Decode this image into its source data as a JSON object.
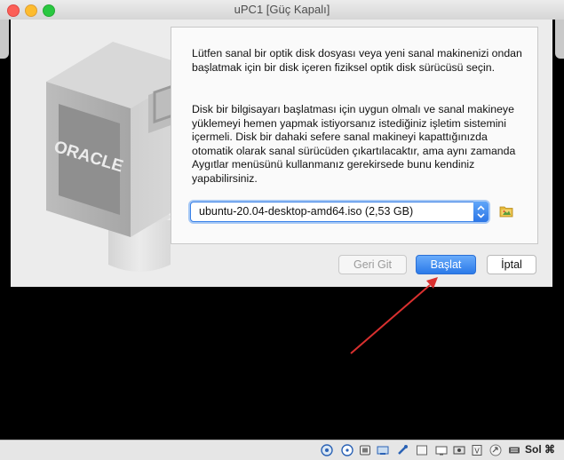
{
  "window": {
    "title": "uPC1 [Güç Kapalı]"
  },
  "logo": {
    "text": "ORACLE"
  },
  "dialog": {
    "paragraph1": "Lütfen sanal bir optik disk dosyası veya yeni sanal makinenizi ondan başlatmak için bir disk içeren fiziksel optik disk sürücüsü seçin.",
    "paragraph2": "Disk bir bilgisayarı başlatması için uygun olmalı ve sanal makineye yüklemeyi hemen yapmak istiyorsanız istediğiniz işletim sistemini içermeli. Disk bir dahaki sefere sanal makineyi kapattığınızda otomatik olarak sanal sürücüden çıkartılacaktır, ama aynı zamanda Aygıtlar menüsünü kullanmanız gerekirsede bunu kendiniz yapabilirsiniz.",
    "disk_select": {
      "value": "ubuntu-20.04-desktop-amd64.iso (2,53 GB)"
    },
    "folder_icon": "folder-icon",
    "buttons": {
      "back": "Geri Git",
      "start": "Başlat",
      "cancel": "İptal"
    }
  },
  "statusbar": {
    "icons": [
      "hard-disk-icon",
      "optical-drive-icon",
      "audio-icon",
      "network-icon",
      "usb-icon",
      "shared-folder-icon",
      "display-icon",
      "video-capture-icon",
      "cpu-icon",
      "arrow-icon",
      "keyboard-icon"
    ],
    "host_key": "Sol ⌘"
  },
  "colors": {
    "accent": "#2b7ae9",
    "annotation_arrow": "#d9302f"
  }
}
